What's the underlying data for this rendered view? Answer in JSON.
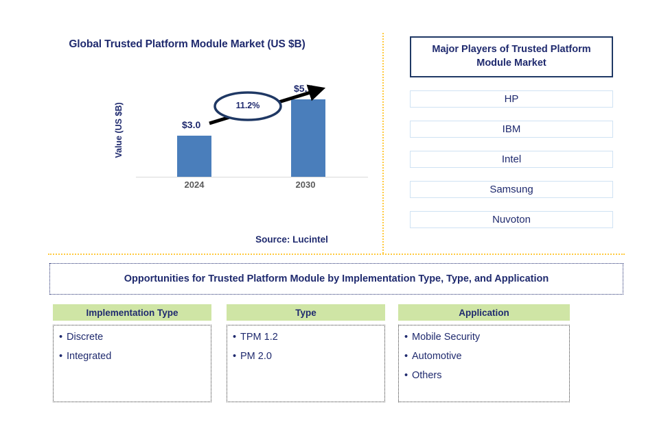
{
  "chart_panel": {
    "title": "Global Trusted Platform Module Market (US $B)",
    "y_axis_label": "Value (US $B)",
    "source": "Source: Lucintel"
  },
  "chart_data": {
    "type": "bar",
    "title": "Global Trusted Platform Module Market (US $B)",
    "xlabel": "",
    "ylabel": "Value (US $B)",
    "categories": [
      "2024",
      "2030"
    ],
    "values": [
      3.0,
      5.7
    ],
    "value_labels": [
      "$3.0",
      "$5.7"
    ],
    "ylim": [
      0,
      6.5
    ],
    "grid": false,
    "legend": "none",
    "bar_color": "#4a7ebb",
    "annotations": [
      {
        "text": "11.2%",
        "type": "cagr-ellipse-with-arrow",
        "from": "2024",
        "to": "2030"
      }
    ]
  },
  "players": {
    "title": "Major Players of Trusted Platform Module Market",
    "items": [
      "HP",
      "IBM",
      "Intel",
      "Samsung",
      "Nuvoton"
    ]
  },
  "opportunities": {
    "banner": "Opportunities for Trusted Platform Module by Implementation Type, Type, and Application",
    "columns": [
      {
        "header": "Implementation Type",
        "items": [
          "Discrete",
          "Integrated"
        ]
      },
      {
        "header": "Type",
        "items": [
          "TPM 1.2",
          "PM 2.0"
        ]
      },
      {
        "header": "Application",
        "items": [
          "Mobile Security",
          "Automotive",
          "Others"
        ]
      }
    ]
  },
  "colors": {
    "navy": "#1f2a6e",
    "bar_blue": "#4a7ebb",
    "divider_yellow": "#ffc93c",
    "header_green": "#cfe5a5",
    "player_border": "#cfe2f3"
  }
}
